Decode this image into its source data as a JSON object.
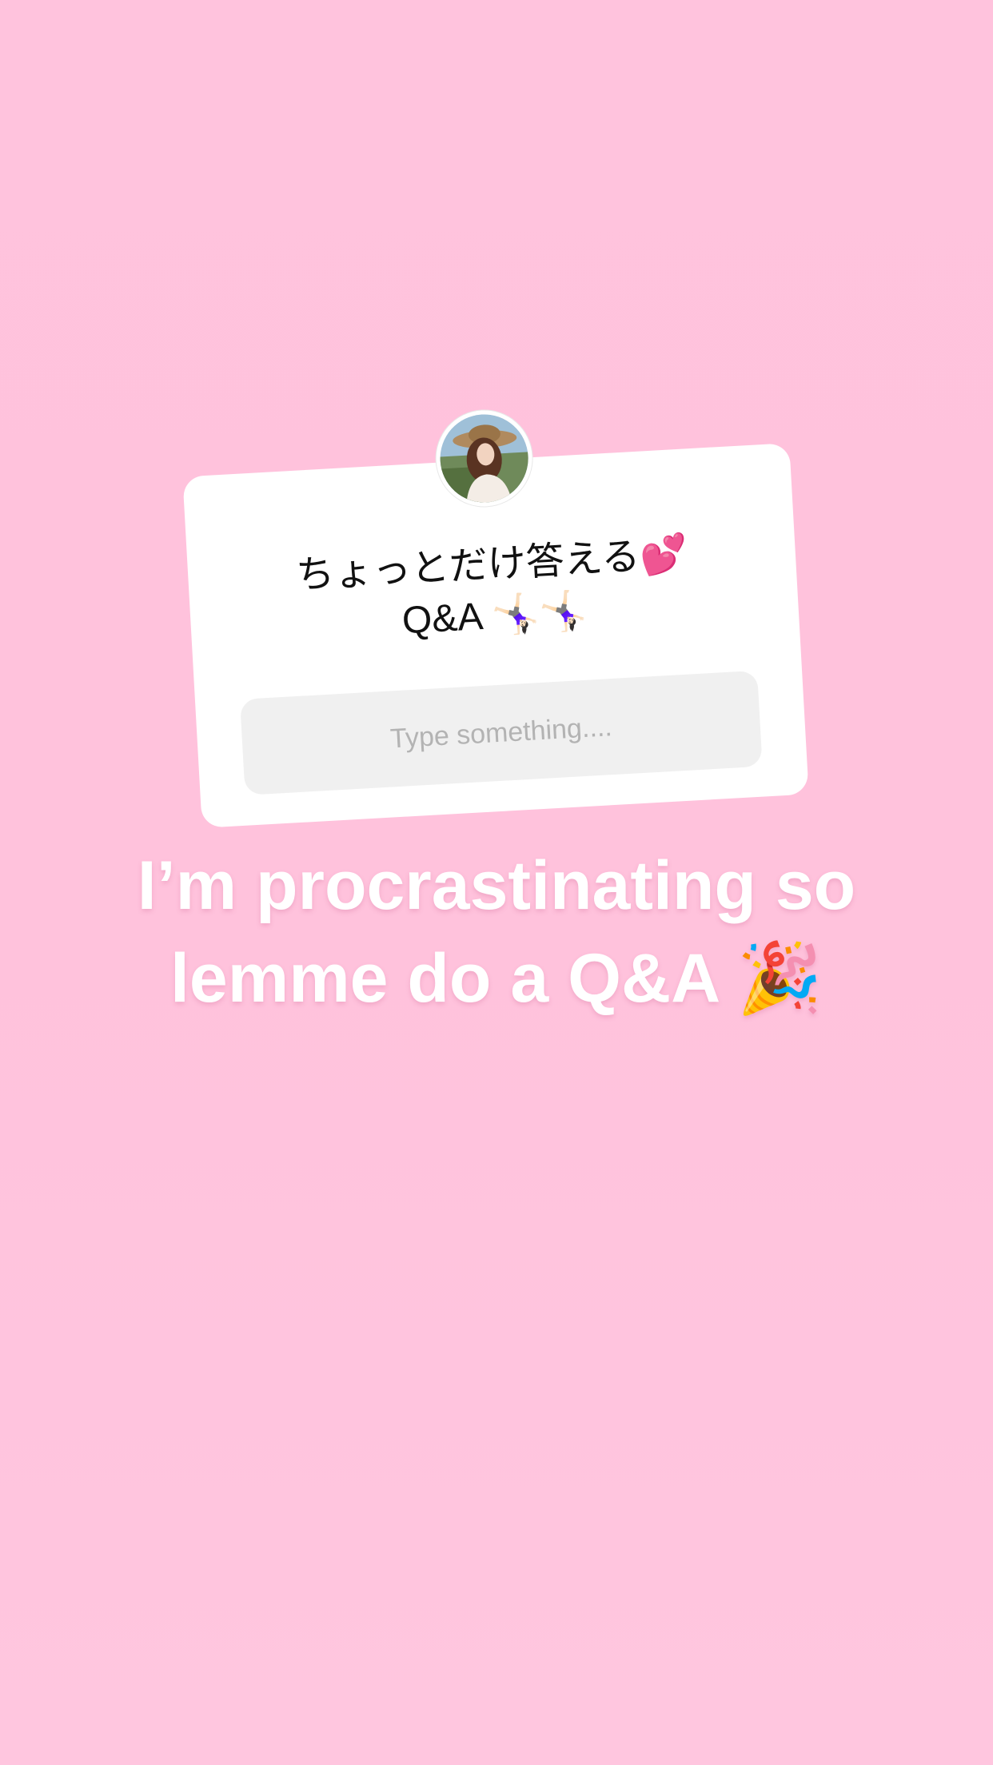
{
  "sticker": {
    "title_line1": "ちょっとだけ答える💕",
    "title_line2": "Q&A 🤸🏻‍♀️🤸🏻‍♀️",
    "input_placeholder": "Type something...."
  },
  "caption": {
    "line1": "I’m procrastinating so",
    "line2": "lemme do a Q&A 🎉"
  },
  "colors": {
    "background": "#ffc4de",
    "card": "#ffffff",
    "input_bg": "#f0f0f0",
    "placeholder": "#b3b3b3",
    "caption_text": "#ffffff"
  }
}
